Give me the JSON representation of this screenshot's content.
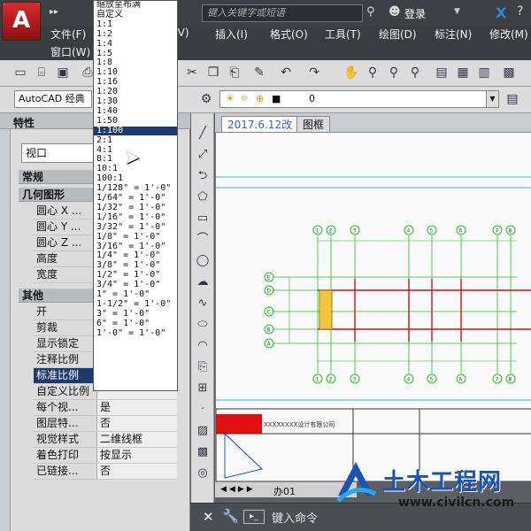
{
  "window": {
    "search_placeholder": "键入关键字或短语",
    "login_label": "登录",
    "app_letter": "A",
    "x_letter": "X"
  },
  "menus": [
    "文件(F)",
    "(V)",
    "插入(I)",
    "格式(O)",
    "工具(T)",
    "绘图(D)",
    "标注(N)",
    "修改(M)",
    "窗口(W)"
  ],
  "toolbar": {
    "workspace": "AutoCAD 经典",
    "layer_value": "0"
  },
  "properties": {
    "title": "特性",
    "object_type": "视口",
    "categories": {
      "general": "常规",
      "geometry": "几何图形",
      "misc": "其他"
    },
    "geometry_rows": [
      "圆心 X ...",
      "圆心 Y ...",
      "圆心 Z ...",
      "高度",
      "宽度"
    ],
    "misc_rows": [
      {
        "key": "开",
        "value": ""
      },
      {
        "key": "剪裁",
        "value": ""
      },
      {
        "key": "显示锁定",
        "value": ""
      },
      {
        "key": "注释比例",
        "value": ""
      },
      {
        "key": "标准比例",
        "value": ""
      },
      {
        "key": "自定义比例",
        "value": ""
      },
      {
        "key": "每个视...",
        "value": "是"
      },
      {
        "key": "图层特...",
        "value": "否"
      },
      {
        "key": "视觉样式",
        "value": "二维线框"
      },
      {
        "key": "着色打印",
        "value": "按显示"
      },
      {
        "key": "已链接...",
        "value": "否"
      }
    ]
  },
  "scale_list": {
    "options": [
      "缩放至布满",
      "自定义",
      "1:1",
      "1:2",
      "1:4",
      "1:5",
      "1:8",
      "1:10",
      "1:16",
      "1:20",
      "1:30",
      "1:40",
      "1:50",
      "1:100",
      "2:1",
      "4:1",
      "8:1",
      "10:1",
      "100:1",
      "1/128\" = 1'-0\"",
      "1/64\" = 1'-0\"",
      "1/32\" = 1'-0\"",
      "1/16\" = 1'-0\"",
      "3/32\" = 1'-0\"",
      "1/8\" = 1'-0\"",
      "3/16\" = 1'-0\"",
      "1/4\" = 1'-0\"",
      "3/8\" = 1'-0\"",
      "1/2\" = 1'-0\"",
      "3/4\" = 1'-0\"",
      "1\" = 1'-0\"",
      "1-1/2\" = 1'-0\"",
      "3\" = 1'-0\"",
      "6\" = 1'-0\"",
      "1'-0\" = 1'-0\""
    ],
    "selected_index": 13
  },
  "file_tabs": [
    {
      "label": "2017.6.12改"
    },
    {
      "label": "图框"
    }
  ],
  "layout_tab": "办01",
  "command": {
    "placeholder": "键入命令"
  },
  "watermark": {
    "title": "土木工程网",
    "url": "www.civilcn.com"
  },
  "drawing": {
    "grid_labels_top": [
      "1",
      "2",
      "3",
      "4",
      "5",
      "6",
      "7",
      "8"
    ],
    "grid_labels_left": [
      "E",
      "D",
      "C",
      "B",
      "A"
    ],
    "title_block_text": "XXXXXXXX设计有限公司"
  },
  "colors": {
    "accent_selection": "#1d3a6e",
    "red_logo": "#d92b2b",
    "watermark_blue": "#1a53b6"
  }
}
